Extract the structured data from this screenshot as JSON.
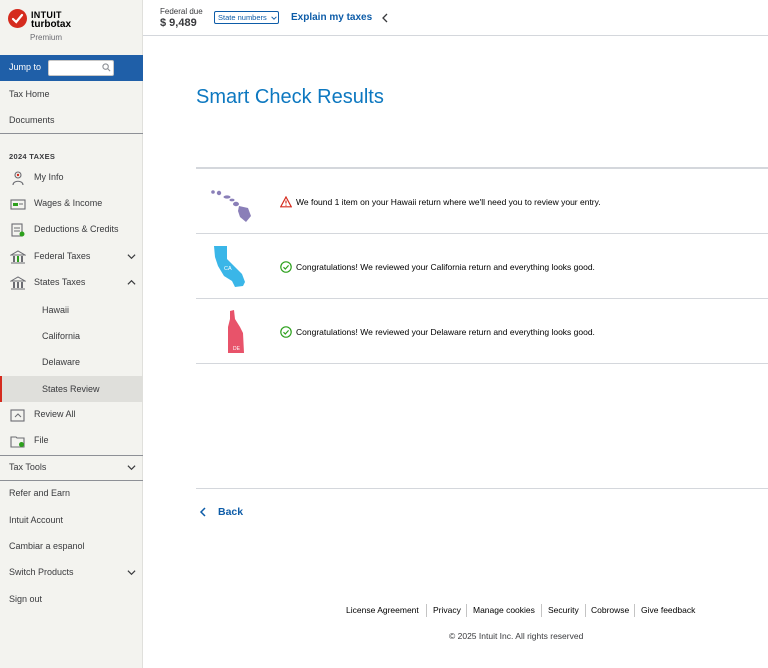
{
  "brand": {
    "line1": "INTUIT",
    "line2": "turbotax",
    "tier": "Premium",
    "accent": "#d52b1e"
  },
  "sidebar": {
    "jump_label": "Jump to",
    "jump_placeholder": "",
    "top_links": [
      "Tax Home",
      "Documents"
    ],
    "section_header": "2024 TAXES",
    "items": [
      {
        "label": "My Info",
        "icon": "person-icon"
      },
      {
        "label": "Wages & Income",
        "icon": "wages-icon"
      },
      {
        "label": "Deductions & Credits",
        "icon": "deductions-icon"
      },
      {
        "label": "Federal Taxes",
        "icon": "federal-building-icon"
      },
      {
        "label": "States Taxes",
        "icon": "state-building-icon"
      }
    ],
    "state_subitems": [
      "Hawaii",
      "California",
      "Delaware",
      "States Review"
    ],
    "active_subitem": "States Review",
    "after_items": [
      {
        "label": "Review All",
        "icon": "review-icon"
      },
      {
        "label": "File",
        "icon": "file-icon"
      }
    ],
    "bottom_links": [
      "Tax Tools",
      "Refer and Earn",
      "Intuit Account",
      "Cambiar a espanol",
      "Switch Products",
      "Sign out"
    ]
  },
  "topbar": {
    "federal_label": "Federal due",
    "federal_amount": "$ 9,489",
    "state_button": "State numbers",
    "explain": "Explain my taxes"
  },
  "main": {
    "title": "Smart Check Results",
    "results": [
      {
        "state_abbr": "HI",
        "status": "warning",
        "message": "We found 1 item on your Hawaii return where we'll need you to review your entry.",
        "color": "#8a7fb8"
      },
      {
        "state_abbr": "CA",
        "status": "ok",
        "message": "Congratulations! We reviewed your California return and everything looks good.",
        "color": "#3ab6e8"
      },
      {
        "state_abbr": "DE",
        "status": "ok",
        "message": "Congratulations! We reviewed your Delaware return and everything looks good.",
        "color": "#e8536a"
      }
    ],
    "back_label": "Back"
  },
  "footer": {
    "links": [
      "License Agreement",
      "Privacy",
      "Manage cookies",
      "Security",
      "Cobrowse",
      "Give feedback"
    ],
    "copyright": "© 2025 Intuit Inc. All rights reserved"
  }
}
